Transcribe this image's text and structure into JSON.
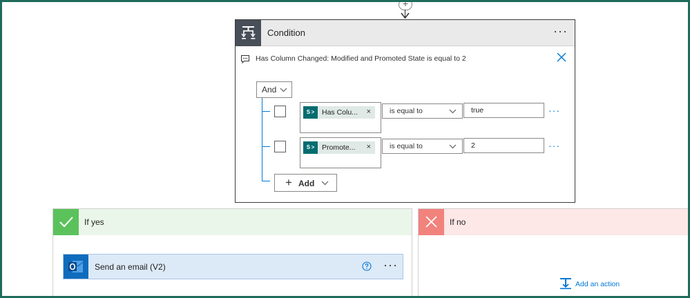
{
  "condition": {
    "title": "Condition",
    "description": "Has Column Changed: Modified and Promoted State is equal to 2",
    "group_operator": "And",
    "rows": [
      {
        "token_label": "Has Colu...",
        "operator": "is equal to",
        "value": "true"
      },
      {
        "token_label": "Promote...",
        "operator": "is equal to",
        "value": "2"
      }
    ],
    "add_label": "Add",
    "more_glyph": "···"
  },
  "branches": {
    "yes": {
      "title": "If yes",
      "actions": [
        {
          "title": "Send an email (V2)"
        }
      ]
    },
    "no": {
      "title": "If no",
      "add_action_label": "Add an action"
    }
  },
  "icons": {
    "condition": "condition-icon",
    "sharepoint": "sharepoint-icon",
    "outlook": "outlook-icon",
    "check": "check-icon",
    "cross": "cross-icon",
    "add_action": "add-action-icon"
  },
  "colors": {
    "accent": "#0078d4",
    "yes": "#5bc25b",
    "no": "#f1827c",
    "sharepoint": "#036c70",
    "outlook": "#0f6cbd",
    "frame": "#1e6b5c"
  }
}
